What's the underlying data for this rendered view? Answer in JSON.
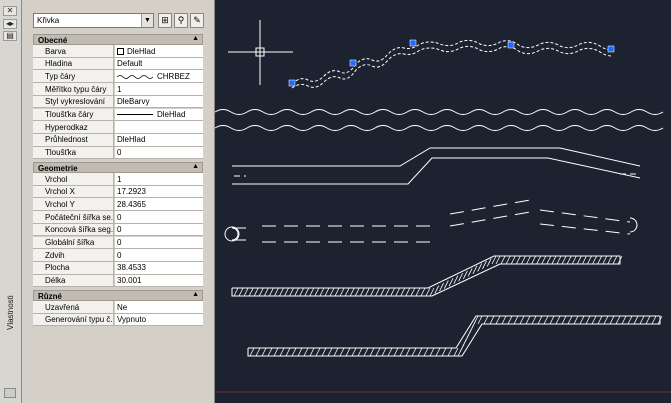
{
  "palette": {
    "title": "Vlastnosti"
  },
  "selector": {
    "value": "Křivka"
  },
  "toolbar": {
    "icons": [
      "select-objects-icon",
      "quick-select-icon",
      "toggle-pickadd-icon"
    ]
  },
  "sections": {
    "general": {
      "title": "Obecné",
      "rows": [
        {
          "label": "Barva",
          "value": "DleHlad"
        },
        {
          "label": "Hladina",
          "value": "Default"
        },
        {
          "label": "Typ čáry",
          "value": "CHRBEZ"
        },
        {
          "label": "Měřítko typu čáry",
          "value": "1"
        },
        {
          "label": "Styl vykreslování",
          "value": "DleBarvy"
        },
        {
          "label": "Tloušťka čáry",
          "value": "DleHlad"
        },
        {
          "label": "Hyperodkaz",
          "value": ""
        },
        {
          "label": "Průhlednost",
          "value": "DleHlad"
        },
        {
          "label": "Tloušťka",
          "value": "0"
        }
      ]
    },
    "geometry": {
      "title": "Geometrie",
      "rows": [
        {
          "label": "Vrchol",
          "value": "1"
        },
        {
          "label": "Vrchol X",
          "value": "17.2923"
        },
        {
          "label": "Vrchol Y",
          "value": "28.4365"
        },
        {
          "label": "Počáteční šířka se...",
          "value": "0"
        },
        {
          "label": "Koncová šířka seg...",
          "value": "0"
        },
        {
          "label": "Globální šířka",
          "value": "0"
        },
        {
          "label": "Zdvih",
          "value": "0"
        },
        {
          "label": "Plocha",
          "value": "38.4533"
        },
        {
          "label": "Délka",
          "value": "30.001"
        }
      ]
    },
    "misc": {
      "title": "Různé",
      "rows": [
        {
          "label": "Uzavřená",
          "value": "Ne"
        },
        {
          "label": "Generování typu č...",
          "value": "Vypnuto"
        }
      ]
    }
  },
  "colors": {
    "canvas": "#1d2230",
    "grip": "#1e6bff",
    "linework": "#ffffff",
    "panel": "#d4d0c8"
  }
}
